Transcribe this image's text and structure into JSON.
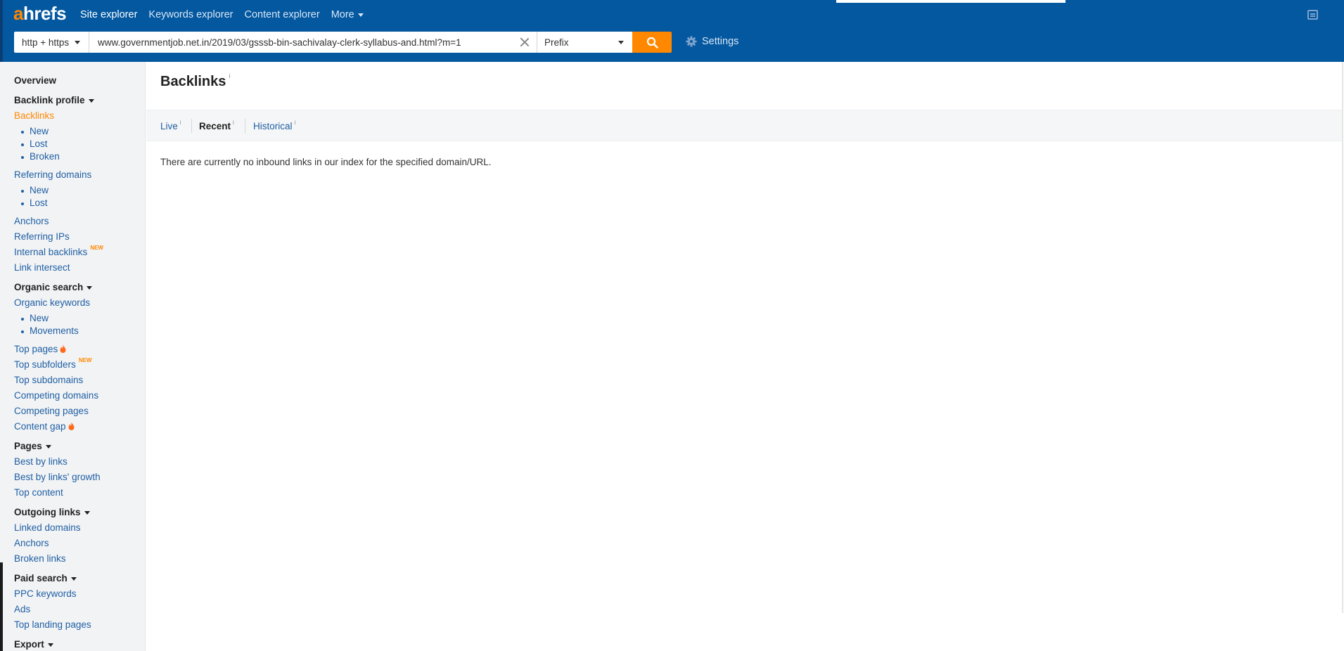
{
  "header": {
    "logo": {
      "accent": "a",
      "rest": "hrefs"
    },
    "nav": [
      {
        "label": "Site explorer",
        "active": true
      },
      {
        "label": "Keywords explorer"
      },
      {
        "label": "Content explorer"
      },
      {
        "label": "More",
        "dropdown": true
      }
    ],
    "search": {
      "protocol": "http + https",
      "url": "www.governmentjob.net.in/2019/03/gsssb-bin-sachivalay-clerk-syllabus-and.html?m=1",
      "mode": "Prefix"
    },
    "settings_label": "Settings",
    "colors": {
      "bar": "#0358a0",
      "accent": "#ff8800"
    }
  },
  "sidebar": {
    "overview": "Overview",
    "backlink_profile": "Backlink profile",
    "backlinks": "Backlinks",
    "backlinks_new": "New",
    "backlinks_lost": "Lost",
    "backlinks_broken": "Broken",
    "referring_domains": "Referring domains",
    "refdomains_new": "New",
    "refdomains_lost": "Lost",
    "anchors": "Anchors",
    "referring_ips": "Referring IPs",
    "internal_backlinks": "Internal backlinks",
    "new_badge": "NEW",
    "link_intersect": "Link intersect",
    "organic_search": "Organic search",
    "organic_keywords": "Organic keywords",
    "organic_new": "New",
    "organic_movements": "Movements",
    "top_pages": "Top pages",
    "top_subfolders": "Top subfolders",
    "top_subdomains": "Top subdomains",
    "competing_domains": "Competing domains",
    "competing_pages": "Competing pages",
    "content_gap": "Content gap",
    "pages": "Pages",
    "best_by_links": "Best by links",
    "best_by_links_growth": "Best by links' growth",
    "top_content": "Top content",
    "outgoing_links": "Outgoing links",
    "linked_domains": "Linked domains",
    "outgoing_anchors": "Anchors",
    "broken_links": "Broken links",
    "paid_search": "Paid search",
    "ppc_keywords": "PPC keywords",
    "ads": "Ads",
    "top_landing_pages": "Top landing pages",
    "export": "Export"
  },
  "main": {
    "title": "Backlinks",
    "info_mark": "i",
    "tabs": [
      {
        "label": "Live"
      },
      {
        "label": "Recent",
        "active": true
      },
      {
        "label": "Historical"
      }
    ],
    "empty_message": "There are currently no inbound links in our index for the specified domain/URL."
  }
}
